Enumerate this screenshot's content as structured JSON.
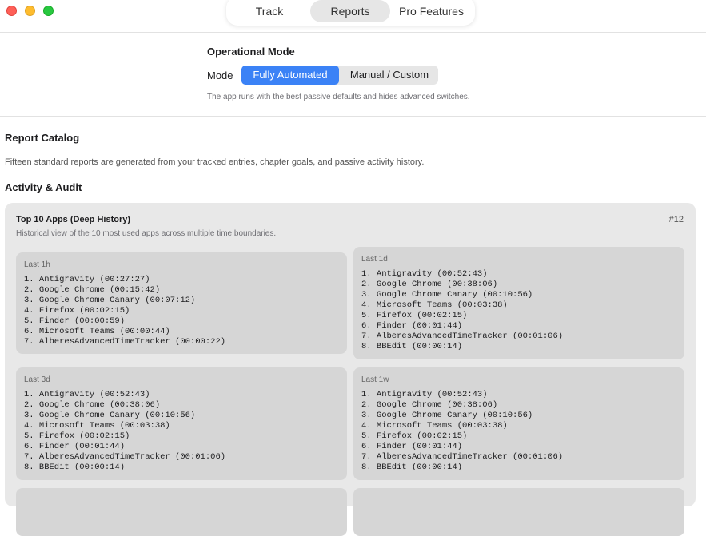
{
  "nav": {
    "tabs": [
      {
        "label": "Track"
      },
      {
        "label": "Reports",
        "selected": true
      },
      {
        "label": "Pro Features"
      }
    ]
  },
  "operational_mode": {
    "title": "Operational Mode",
    "mode_label": "Mode",
    "options": [
      {
        "label": "Fully Automated",
        "selected": true
      },
      {
        "label": "Manual / Custom",
        "selected": false
      }
    ],
    "description": "The app runs with the best passive defaults and hides advanced switches."
  },
  "catalog": {
    "title": "Report Catalog",
    "description": "Fifteen standard reports are generated from your tracked entries, chapter goals, and passive activity history."
  },
  "section": {
    "title": "Activity & Audit"
  },
  "report": {
    "title": "Top 10 Apps (Deep History)",
    "number": "#12",
    "description": "Historical view of the 10 most used apps across multiple time boundaries.",
    "buckets": [
      {
        "label": "Last 1h",
        "items": [
          "1. Antigravity (00:27:27)",
          "2. Google Chrome (00:15:42)",
          "3. Google Chrome Canary (00:07:12)",
          "4. Firefox (00:02:15)",
          "5. Finder (00:00:59)",
          "6. Microsoft Teams (00:00:44)",
          "7. AlberesAdvancedTimeTracker (00:00:22)"
        ]
      },
      {
        "label": "Last 1d",
        "items": [
          "1. Antigravity (00:52:43)",
          "2. Google Chrome (00:38:06)",
          "3. Google Chrome Canary (00:10:56)",
          "4. Microsoft Teams (00:03:38)",
          "5. Firefox (00:02:15)",
          "6. Finder (00:01:44)",
          "7. AlberesAdvancedTimeTracker (00:01:06)",
          "8. BBEdit (00:00:14)"
        ]
      },
      {
        "label": "Last 3d",
        "items": [
          "1. Antigravity (00:52:43)",
          "2. Google Chrome (00:38:06)",
          "3. Google Chrome Canary (00:10:56)",
          "4. Microsoft Teams (00:03:38)",
          "5. Firefox (00:02:15)",
          "6. Finder (00:01:44)",
          "7. AlberesAdvancedTimeTracker (00:01:06)",
          "8. BBEdit (00:00:14)"
        ]
      },
      {
        "label": "Last 1w",
        "items": [
          "1. Antigravity (00:52:43)",
          "2. Google Chrome (00:38:06)",
          "3. Google Chrome Canary (00:10:56)",
          "4. Microsoft Teams (00:03:38)",
          "5. Firefox (00:02:15)",
          "6. Finder (00:01:44)",
          "7. AlberesAdvancedTimeTracker (00:01:06)",
          "8. BBEdit (00:00:14)"
        ]
      }
    ]
  },
  "colors": {
    "accent": "#3b82f6",
    "close": "#fe5f57",
    "minimize": "#febc2e",
    "maximize": "#28c840"
  }
}
